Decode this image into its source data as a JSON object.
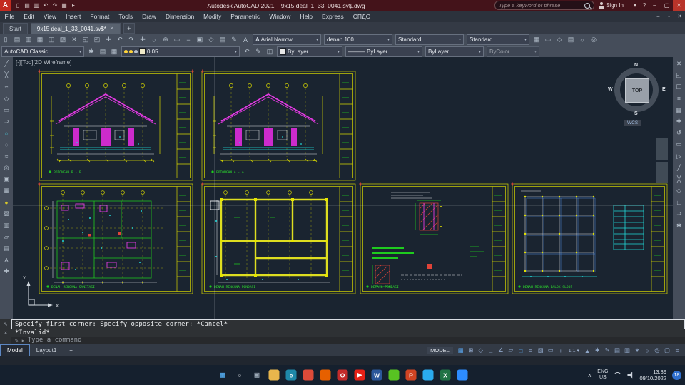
{
  "ui": {
    "dropdown_arrow": "▾"
  },
  "titlebar": {
    "logo": "A",
    "title": "Autodesk AutoCAD 2021    9x15 deal_1_33_0041.sv$.dwg",
    "search_placeholder": "Type a keyword or phrase",
    "sign_in": "Sign In",
    "qat_icons": [
      {
        "name": "qat-new-icon",
        "glyph": "▯"
      },
      {
        "name": "qat-open-icon",
        "glyph": "▤"
      },
      {
        "name": "qat-save-icon",
        "glyph": "▥"
      },
      {
        "name": "qat-undo-icon",
        "glyph": "↶"
      },
      {
        "name": "qat-redo-icon",
        "glyph": "↷"
      },
      {
        "name": "qat-plot-icon",
        "glyph": "▦"
      },
      {
        "name": "qat-workspace-icon",
        "glyph": "▸"
      }
    ],
    "extra_icons": [
      {
        "name": "notification-icon",
        "glyph": "▾"
      },
      {
        "name": "help-icon",
        "glyph": "?"
      }
    ]
  },
  "window_controls": {
    "minimize": "–",
    "maximize": "▢",
    "close": "✕"
  },
  "doc_window_controls": {
    "minimize": "–",
    "restore": "▫",
    "close": "✕"
  },
  "menubar": {
    "items": [
      "File",
      "Edit",
      "View",
      "Insert",
      "Format",
      "Tools",
      "Draw",
      "Dimension",
      "Modify",
      "Parametric",
      "Window",
      "Help",
      "Express",
      "СПДС"
    ]
  },
  "doc_tabs": {
    "start": "Start",
    "active": "9x15 deal_1_33_0041.sv$*",
    "close": "✕",
    "add": "+"
  },
  "toolbar1": {
    "icons": [
      {
        "name": "new-icon",
        "glyph": "▯"
      },
      {
        "name": "open-icon",
        "glyph": "▤"
      },
      {
        "name": "save-icon",
        "glyph": "▥"
      },
      {
        "name": "plot-icon",
        "glyph": "▦"
      },
      {
        "name": "preview-icon",
        "glyph": "◫"
      },
      {
        "name": "publish-icon",
        "glyph": "▧"
      },
      {
        "name": "cut-icon",
        "glyph": "✕"
      },
      {
        "name": "copy-icon",
        "glyph": "◱"
      },
      {
        "name": "paste-icon",
        "glyph": "◰"
      },
      {
        "name": "match-properties-icon",
        "glyph": "✚"
      },
      {
        "name": "undo-icon",
        "glyph": "↶"
      },
      {
        "name": "redo-icon",
        "glyph": "↷"
      },
      {
        "name": "pan-icon",
        "glyph": "✚"
      },
      {
        "name": "zoom-realtime-icon",
        "glyph": "○"
      },
      {
        "name": "zoom-window-icon",
        "glyph": "⊕"
      },
      {
        "name": "zoom-previous-icon",
        "glyph": "▭"
      },
      {
        "name": "properties-icon",
        "glyph": "≡"
      },
      {
        "name": "design-center-icon",
        "glyph": "▣"
      },
      {
        "name": "tool-palettes-icon",
        "glyph": "◇"
      },
      {
        "name": "sheet-set-icon",
        "glyph": "▤"
      },
      {
        "name": "markup-icon",
        "glyph": "✎"
      },
      {
        "name": "quickcalc-icon",
        "glyph": "A"
      }
    ],
    "text_style_icon": "A",
    "text_style": "Arial Narrow",
    "dim_style": "denah 100",
    "table_style": "Standard",
    "mleader_style": "Standard",
    "right_icons": [
      {
        "name": "table-icon",
        "glyph": "▦"
      },
      {
        "name": "field-icon",
        "glyph": "▭"
      },
      {
        "name": "block-editor-icon",
        "glyph": "◇"
      },
      {
        "name": "xref-icon",
        "glyph": "▤"
      },
      {
        "name": "hyperlink-icon",
        "glyph": "○"
      },
      {
        "name": "render-icon",
        "glyph": "◎"
      }
    ]
  },
  "toolbar2": {
    "workspace": "AutoCAD Classic",
    "pre_icons": [
      {
        "name": "workspace-settings-icon",
        "glyph": "✱"
      },
      {
        "name": "layer-properties-icon",
        "glyph": "▤"
      },
      {
        "name": "layer-states-icon",
        "glyph": "▦"
      }
    ],
    "layer_value": "0.05",
    "mid_icons": [
      {
        "name": "layer-previous-icon",
        "glyph": "↶"
      },
      {
        "name": "make-current-icon",
        "glyph": "✎"
      },
      {
        "name": "match-layer-icon",
        "glyph": "◫"
      }
    ],
    "color": "ByLayer",
    "linetype_prefix": "———",
    "linetype": "ByLayer",
    "lineweight": "ByLayer",
    "plot_style": "ByColor"
  },
  "left_toolbar": {
    "icons": [
      {
        "name": "line-tool-icon",
        "glyph": "╱"
      },
      {
        "name": "xline-tool-icon",
        "glyph": "╳"
      },
      {
        "name": "polyline-tool-icon",
        "glyph": "≈"
      },
      {
        "name": "polygon-tool-icon",
        "glyph": "◇"
      },
      {
        "name": "rectangle-tool-icon",
        "glyph": "▭"
      },
      {
        "name": "arc-tool-icon",
        "glyph": "⊃"
      },
      {
        "name": "circle-tool-icon",
        "glyph": "○",
        "glyph_color": "#49c8d8"
      },
      {
        "name": "revcloud-tool-icon",
        "glyph": "◌"
      },
      {
        "name": "spline-tool-icon",
        "glyph": "≈"
      },
      {
        "name": "ellipse-tool-icon",
        "glyph": "◎"
      },
      {
        "name": "insert-block-icon",
        "glyph": "▣"
      },
      {
        "name": "make-block-icon",
        "glyph": "▦"
      },
      {
        "name": "point-tool-icon",
        "glyph": "●",
        "glyph_color": "#d8c82a"
      },
      {
        "name": "hatch-tool-icon",
        "glyph": "▨"
      },
      {
        "name": "gradient-tool-icon",
        "glyph": "▥"
      },
      {
        "name": "region-tool-icon",
        "glyph": "▱"
      },
      {
        "name": "table-tool-icon",
        "glyph": "▤"
      },
      {
        "name": "text-tool-icon",
        "glyph": "A"
      },
      {
        "name": "addselect-tool-icon",
        "glyph": "✚"
      }
    ]
  },
  "right_toolbar": {
    "icons": [
      {
        "name": "erase-tool-icon",
        "glyph": "✕"
      },
      {
        "name": "copy-tool-icon",
        "glyph": "◱"
      },
      {
        "name": "mirror-tool-icon",
        "glyph": "◫"
      },
      {
        "name": "offset-tool-icon",
        "glyph": "≡"
      },
      {
        "name": "array-tool-icon",
        "glyph": "▦"
      },
      {
        "name": "move-tool-icon",
        "glyph": "✚"
      },
      {
        "name": "rotate-tool-icon",
        "glyph": "↺"
      },
      {
        "name": "scale-tool-icon",
        "glyph": "▭"
      },
      {
        "name": "stretch-tool-icon",
        "glyph": "▷"
      },
      {
        "name": "trim-tool-icon",
        "glyph": "╱"
      },
      {
        "name": "extend-tool-icon",
        "glyph": "╳"
      },
      {
        "name": "break-tool-icon",
        "glyph": "◇"
      },
      {
        "name": "chamfer-tool-icon",
        "glyph": "∟"
      },
      {
        "name": "fillet-tool-icon",
        "glyph": "⊃"
      },
      {
        "name": "explode-tool-icon",
        "glyph": "✱"
      }
    ]
  },
  "viewport": {
    "label": "[-][Top][2D Wireframe]",
    "compass": {
      "n": "N",
      "w": "W",
      "e": "E",
      "s": "S",
      "top": "TOP",
      "wcs": "WCS"
    },
    "ucs_x": "X",
    "ucs_y": "Y"
  },
  "sheets": [
    {
      "label": "POTONGAN B - B"
    },
    {
      "label": "POTONGAN A - A"
    },
    {
      "label": "DENAH RENCANA SANITASI"
    },
    {
      "label": "DENAH RENCANA PONDASI"
    },
    {
      "label": "DETAIL PONDASI"
    },
    {
      "label": "DENAH RENCANA BALOK SLOOF"
    }
  ],
  "command": {
    "side_icon1": "✎",
    "side_icon2": "✕",
    "line1": "Specify first corner: Specify opposite corner: *Cancel*",
    "line2": "*Invalid*",
    "prompt_icon": "✎",
    "caret": "▸",
    "prompt_placeholder": "Type a command"
  },
  "layout_tabs": {
    "model": "Model",
    "layout1": "Layout1",
    "add": "+"
  },
  "statusbar": {
    "model_label": "MODEL",
    "scale": "1:1 ▾",
    "icons1": [
      {
        "name": "grid-toggle",
        "glyph": "▦",
        "glyph_color": "#5aa7f0"
      },
      {
        "name": "snap-toggle",
        "glyph": "⊞"
      },
      {
        "name": "infer-constraints-toggle",
        "glyph": "◇"
      },
      {
        "name": "ortho-toggle",
        "glyph": "∟"
      },
      {
        "name": "polar-toggle",
        "glyph": "∠"
      },
      {
        "name": "isodraft-toggle",
        "glyph": "▱"
      },
      {
        "name": "osnap-toggle",
        "glyph": "□",
        "glyph_color": "#5aa7f0"
      },
      {
        "name": "lineweight-toggle",
        "glyph": "≡"
      },
      {
        "name": "transparency-toggle",
        "glyph": "▨"
      },
      {
        "name": "selection-cycling-toggle",
        "glyph": "▭"
      },
      {
        "name": "dynamic-input-toggle",
        "glyph": "+"
      }
    ],
    "icons2": [
      {
        "name": "annotation-visibility-icon",
        "glyph": "▲"
      },
      {
        "name": "workspace-switch-icon",
        "glyph": "✱"
      },
      {
        "name": "annotation-monitor-icon",
        "glyph": "✎"
      },
      {
        "name": "units-icon",
        "glyph": "▤"
      },
      {
        "name": "quick-properties-icon",
        "glyph": "▥"
      },
      {
        "name": "lock-ui-icon",
        "glyph": "∗"
      },
      {
        "name": "isolate-objects-icon",
        "glyph": "○"
      },
      {
        "name": "graphics-performance-icon",
        "glyph": "◎"
      },
      {
        "name": "clean-screen-icon",
        "glyph": "▢"
      },
      {
        "name": "customize-icon",
        "glyph": "≡"
      }
    ]
  },
  "taskbar": {
    "icons": [
      {
        "name": "start-button",
        "glyph": "▦",
        "glyph_color": "#4fa3e3"
      },
      {
        "name": "search-button",
        "glyph": "○",
        "glyph_color": "#d0d6de"
      },
      {
        "name": "task-view-button",
        "glyph": "▣",
        "glyph_color": "#9aa7b5"
      },
      {
        "name": "file-explorer-icon",
        "color": "#e8b64c"
      },
      {
        "name": "edge-icon",
        "glyph": "e",
        "color": "#1e88a8"
      },
      {
        "name": "chrome-icon",
        "color": "#dd4b39"
      },
      {
        "name": "firefox-icon",
        "color": "#e66000"
      },
      {
        "name": "opera-icon",
        "glyph": "O",
        "color": "#c42b2b"
      },
      {
        "name": "youtube-icon",
        "glyph": "▶",
        "color": "#e62117"
      },
      {
        "name": "word-icon",
        "glyph": "W",
        "color": "#2b579a"
      },
      {
        "name": "wechat-icon",
        "color": "#58c322"
      },
      {
        "name": "powerpoint-icon",
        "glyph": "P",
        "color": "#d04423"
      },
      {
        "name": "telegram-icon",
        "color": "#2aabee"
      },
      {
        "name": "excel-icon",
        "glyph": "X",
        "color": "#217346"
      },
      {
        "name": "zoom-icon",
        "color": "#2d8cff"
      }
    ],
    "tray_chevron": "∧",
    "lang": "ENG",
    "region": "US",
    "time": "13:39",
    "date": "09/10/2022",
    "badge": "18"
  }
}
